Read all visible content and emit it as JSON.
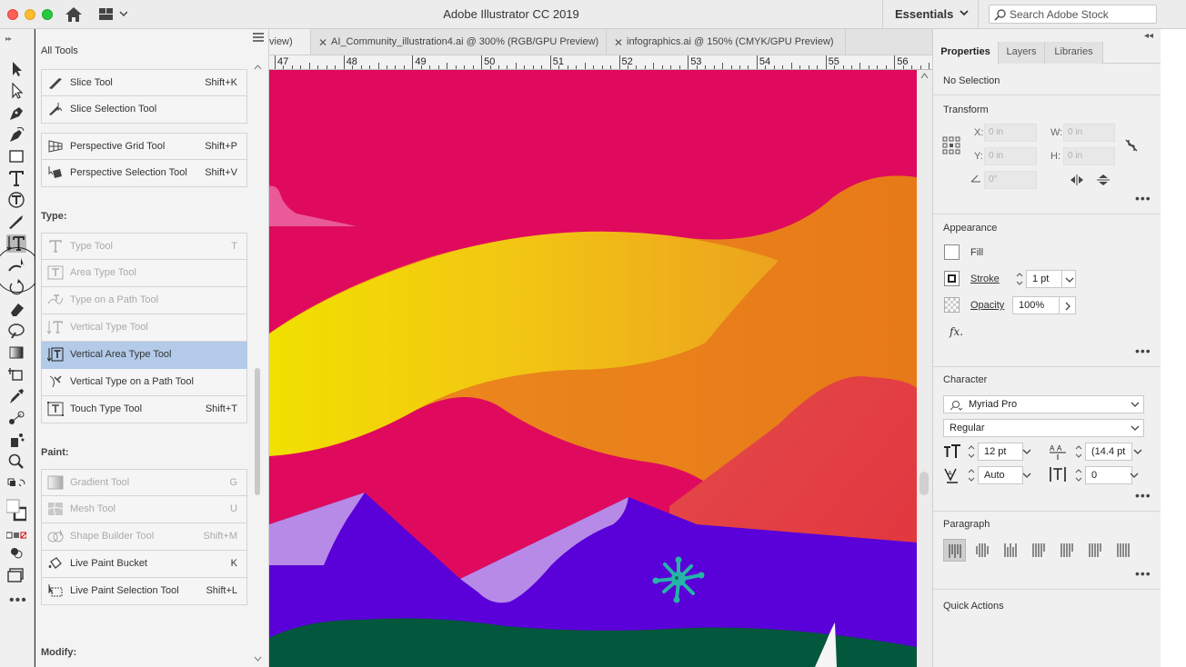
{
  "titlebar": {
    "title": "Adobe Illustrator CC 2019",
    "workspace": "Essentials",
    "search_placeholder": "Search Adobe Stock"
  },
  "drawer": {
    "title": "All Tools",
    "groups": [
      {
        "tools": [
          {
            "name": "Slice Tool",
            "shortcut": "Shift+K",
            "state": "normal",
            "icon": "slice-icon"
          },
          {
            "name": "Slice Selection Tool",
            "shortcut": "",
            "state": "normal",
            "icon": "slice-selection-icon"
          }
        ]
      },
      {
        "tools": [
          {
            "name": "Perspective Grid Tool",
            "shortcut": "Shift+P",
            "state": "normal",
            "icon": "perspective-grid-icon"
          },
          {
            "name": "Perspective Selection Tool",
            "shortcut": "Shift+V",
            "state": "normal",
            "icon": "perspective-selection-icon"
          }
        ]
      }
    ],
    "sections": [
      {
        "label": "Type:",
        "tools": [
          {
            "name": "Type Tool",
            "shortcut": "T",
            "state": "disabled",
            "icon": "type-icon"
          },
          {
            "name": "Area Type Tool",
            "shortcut": "",
            "state": "disabled",
            "icon": "area-type-icon"
          },
          {
            "name": "Type on a Path Tool",
            "shortcut": "",
            "state": "disabled",
            "icon": "type-on-path-icon"
          },
          {
            "name": "Vertical Type Tool",
            "shortcut": "",
            "state": "disabled",
            "icon": "vertical-type-icon"
          },
          {
            "name": "Vertical Area Type Tool",
            "shortcut": "",
            "state": "selected",
            "icon": "vertical-area-type-icon"
          },
          {
            "name": "Vertical Type on a Path Tool",
            "shortcut": "",
            "state": "normal",
            "icon": "vertical-type-on-path-icon"
          },
          {
            "name": "Touch Type Tool",
            "shortcut": "Shift+T",
            "state": "normal",
            "icon": "touch-type-icon"
          }
        ]
      },
      {
        "label": "Paint:",
        "tools": [
          {
            "name": "Gradient Tool",
            "shortcut": "G",
            "state": "disabled",
            "icon": "gradient-icon"
          },
          {
            "name": "Mesh Tool",
            "shortcut": "U",
            "state": "disabled",
            "icon": "mesh-icon"
          },
          {
            "name": "Shape Builder Tool",
            "shortcut": "Shift+M",
            "state": "disabled",
            "icon": "shape-builder-icon"
          },
          {
            "name": "Live Paint Bucket",
            "shortcut": "K",
            "state": "normal",
            "icon": "live-paint-bucket-icon"
          },
          {
            "name": "Live Paint Selection Tool",
            "shortcut": "Shift+L",
            "state": "normal",
            "icon": "live-paint-selection-icon"
          }
        ]
      },
      {
        "label": "Modify:",
        "tools": []
      }
    ]
  },
  "doc_tabs": [
    {
      "label": "view)",
      "closable": false
    },
    {
      "label": "AI_Community_illustration4.ai @ 300% (RGB/GPU Preview)",
      "closable": true
    },
    {
      "label": "infographics.ai @ 150% (CMYK/GPU Preview)",
      "closable": true
    }
  ],
  "ruler": {
    "labels": [
      "47",
      "48",
      "49",
      "50",
      "51",
      "52",
      "53",
      "54",
      "55",
      "56"
    ]
  },
  "properties": {
    "tabs": [
      "Properties",
      "Layers",
      "Libraries"
    ],
    "selection": "No Selection",
    "transform": {
      "title": "Transform",
      "x_label": "X:",
      "x": "0 in",
      "y_label": "Y:",
      "y": "0 in",
      "w_label": "W:",
      "w": "0 in",
      "h_label": "H:",
      "h": "0 in",
      "angle": "0°"
    },
    "appearance": {
      "title": "Appearance",
      "fill_label": "Fill",
      "stroke_label": "Stroke",
      "stroke_value": "1 pt",
      "opacity_label": "Opacity",
      "opacity_value": "100%",
      "fx_label": "fx."
    },
    "character": {
      "title": "Character",
      "font": "Myriad Pro",
      "style": "Regular",
      "size": "12 pt",
      "leading": "(14.4 pt",
      "kerning": "Auto",
      "tracking": "0"
    },
    "paragraph": {
      "title": "Paragraph"
    },
    "quick_actions": {
      "title": "Quick Actions"
    }
  },
  "colors": {
    "magenta": "#e3005a",
    "yellow": "#f4d400",
    "orange": "#ec8c1a",
    "red": "#e84040",
    "purple": "#5a00d9",
    "lavender": "#b58ae8",
    "green": "#005a3c",
    "teal": "#25b5a5",
    "selection_blue": "#b3cbe9"
  }
}
